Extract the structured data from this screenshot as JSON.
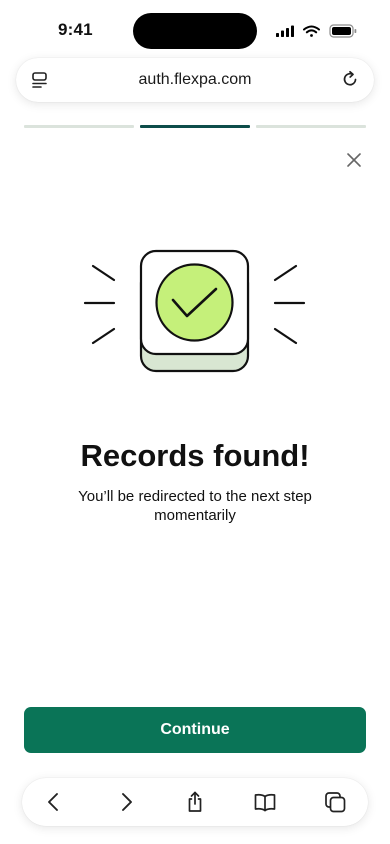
{
  "status_bar": {
    "time": "9:41"
  },
  "browser": {
    "url": "auth.flexpa.com",
    "page_menu_icon": "page-menu-icon",
    "reload_icon": "reload-icon"
  },
  "progress": {
    "steps_total": 3,
    "current_step": 2
  },
  "content": {
    "title": "Records found!",
    "subtitle": "You’ll be redirected to the next step momentarily",
    "continue_label": "Continue"
  },
  "toolbar": {
    "icons": [
      "back-icon",
      "forward-icon",
      "share-icon",
      "bookmarks-icon",
      "tabs-icon"
    ]
  },
  "colors": {
    "accent": "#0a7457",
    "progress_active": "#0d4d4a",
    "progress_inactive": "#dbe3dc",
    "check_fill": "#c5f07a",
    "shadow_tile": "#d8e6d2"
  }
}
